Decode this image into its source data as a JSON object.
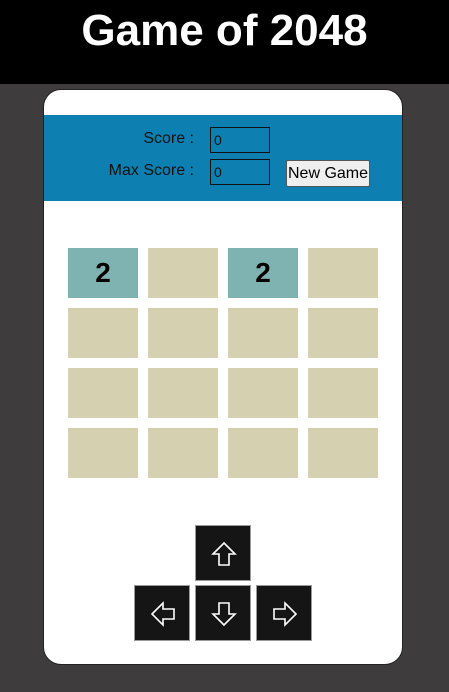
{
  "app": {
    "title": "Game of 2048"
  },
  "scoreboard": {
    "score_label": "Score :",
    "score_value": "0",
    "max_score_label": "Max Score :",
    "max_score_value": "0",
    "new_game_label": "New Game"
  },
  "board": {
    "rows": [
      [
        "2",
        "",
        "2",
        ""
      ],
      [
        "",
        "",
        "",
        ""
      ],
      [
        "",
        "",
        "",
        ""
      ],
      [
        "",
        "",
        "",
        ""
      ]
    ]
  },
  "controls": {
    "icons": [
      "arrow-up-icon",
      "arrow-left-icon",
      "arrow-down-icon",
      "arrow-right-icon"
    ]
  },
  "colors": {
    "header_band": "#0d7fb1",
    "tile_empty": "#d5d0b0",
    "tile_2": "#7fb3b1",
    "background": "#3e3c3d",
    "control_button": "#151515"
  }
}
